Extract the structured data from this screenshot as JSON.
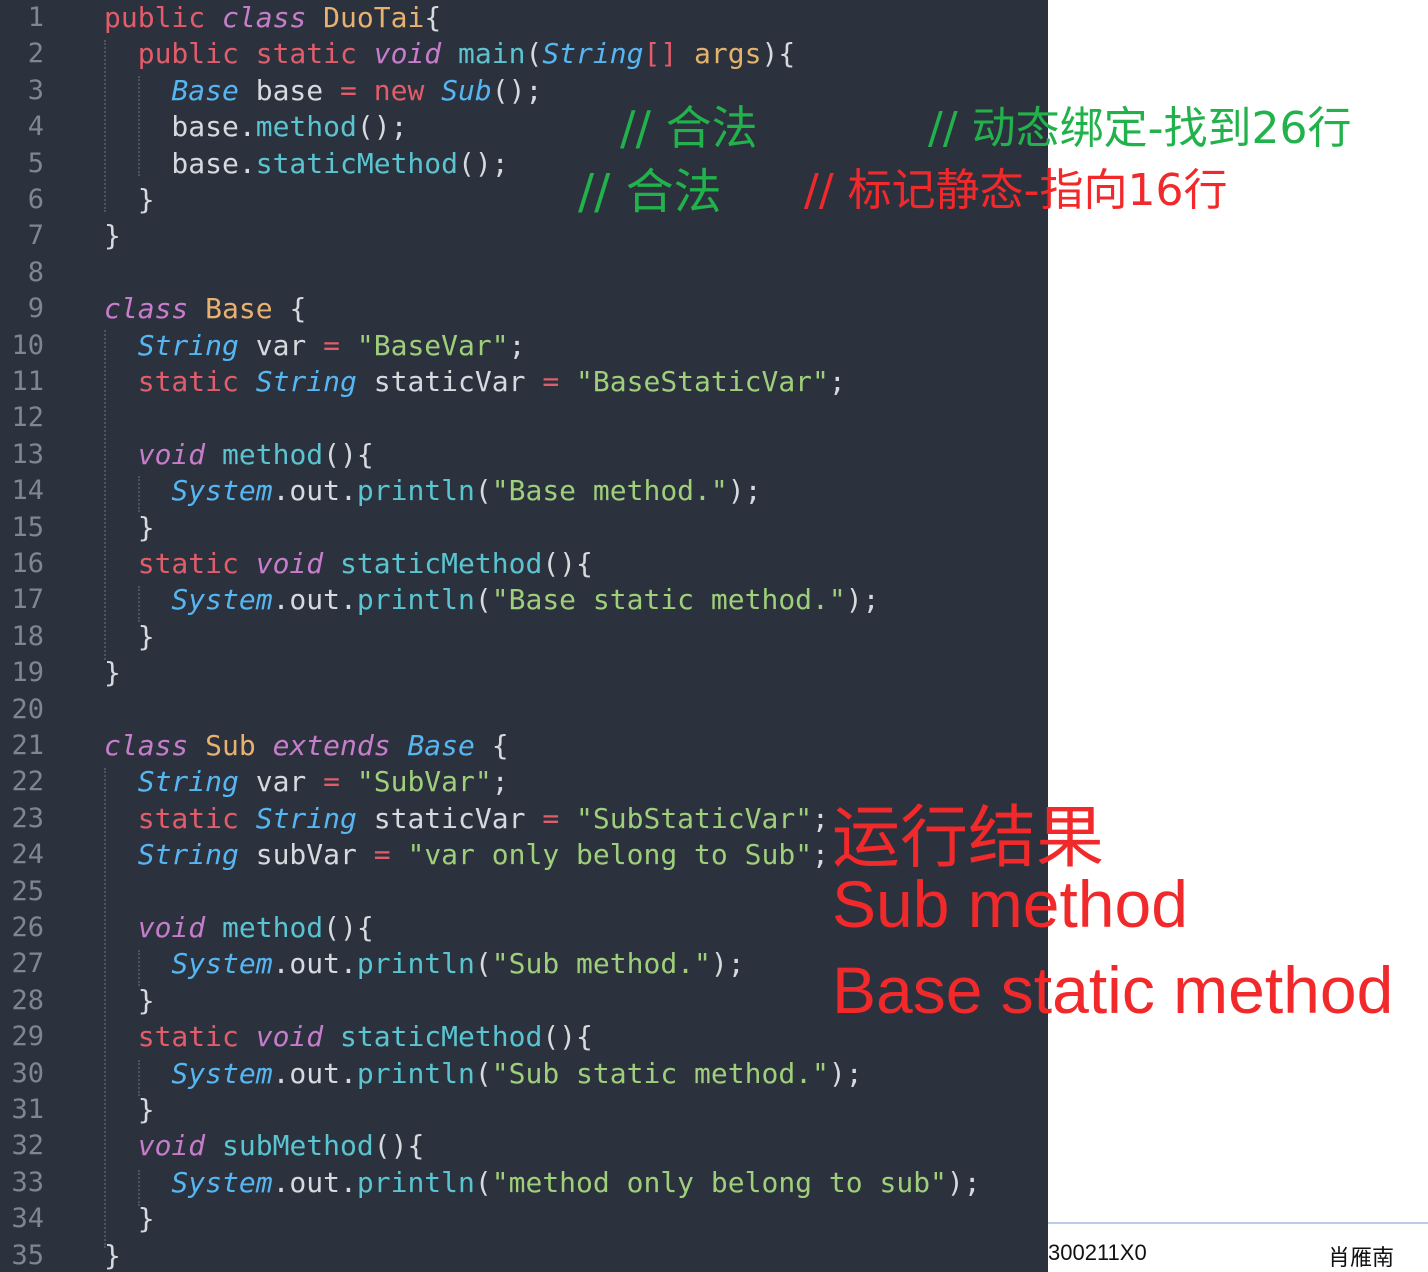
{
  "editor": {
    "line_numbers": [
      "1",
      "2",
      "3",
      "4",
      "5",
      "6",
      "7",
      "8",
      "9",
      "10",
      "11",
      "12",
      "13",
      "14",
      "15",
      "16",
      "17",
      "18",
      "19",
      "20",
      "21",
      "22",
      "23",
      "24",
      "25",
      "26",
      "27",
      "28",
      "29",
      "30",
      "31",
      "32",
      "33",
      "34",
      "35"
    ],
    "lines": [
      [
        [
          "k",
          "public "
        ],
        [
          "ki",
          "class "
        ],
        [
          "t",
          "DuoTai"
        ],
        [
          "p",
          "{"
        ]
      ],
      [
        [
          "k",
          "  public static "
        ],
        [
          "ki",
          "void "
        ],
        [
          "f",
          "main"
        ],
        [
          "p",
          "("
        ],
        [
          "ti",
          "String"
        ],
        [
          "k",
          "[] "
        ],
        [
          "arg",
          "args"
        ],
        [
          "p",
          "){"
        ]
      ],
      [
        [
          "ti",
          "    Base "
        ],
        [
          "p",
          "base "
        ],
        [
          "k",
          "= new "
        ],
        [
          "ti",
          "Sub"
        ],
        [
          "p",
          "();"
        ]
      ],
      [
        [
          "p",
          "    base."
        ],
        [
          "f",
          "method"
        ],
        [
          "p",
          "();"
        ]
      ],
      [
        [
          "p",
          "    base."
        ],
        [
          "f",
          "staticMethod"
        ],
        [
          "p",
          "();"
        ]
      ],
      [
        [
          "p",
          "  }"
        ]
      ],
      [
        [
          "p",
          "}"
        ]
      ],
      [],
      [
        [
          "ki",
          "class "
        ],
        [
          "t",
          "Base "
        ],
        [
          "p",
          "{"
        ]
      ],
      [
        [
          "ti",
          "  String "
        ],
        [
          "p",
          "var "
        ],
        [
          "k",
          "= "
        ],
        [
          "q",
          "\""
        ],
        [
          "s",
          "BaseVar"
        ],
        [
          "q",
          "\""
        ],
        [
          "p",
          ";"
        ]
      ],
      [
        [
          "k",
          "  static "
        ],
        [
          "ti",
          "String "
        ],
        [
          "p",
          "staticVar "
        ],
        [
          "k",
          "= "
        ],
        [
          "q",
          "\""
        ],
        [
          "s",
          "BaseStaticVar"
        ],
        [
          "q",
          "\""
        ],
        [
          "p",
          ";"
        ]
      ],
      [],
      [
        [
          "ki",
          "  void "
        ],
        [
          "f",
          "method"
        ],
        [
          "p",
          "(){"
        ]
      ],
      [
        [
          "ti",
          "    System"
        ],
        [
          "p",
          ".out."
        ],
        [
          "f",
          "println"
        ],
        [
          "p",
          "("
        ],
        [
          "q",
          "\""
        ],
        [
          "s",
          "Base method."
        ],
        [
          "q",
          "\""
        ],
        [
          "p",
          ");"
        ]
      ],
      [
        [
          "p",
          "  }"
        ]
      ],
      [
        [
          "k",
          "  static "
        ],
        [
          "ki",
          "void "
        ],
        [
          "f",
          "staticMethod"
        ],
        [
          "p",
          "(){"
        ]
      ],
      [
        [
          "ti",
          "    System"
        ],
        [
          "p",
          ".out."
        ],
        [
          "f",
          "println"
        ],
        [
          "p",
          "("
        ],
        [
          "q",
          "\""
        ],
        [
          "s",
          "Base static method."
        ],
        [
          "q",
          "\""
        ],
        [
          "p",
          ");"
        ]
      ],
      [
        [
          "p",
          "  }"
        ]
      ],
      [
        [
          "p",
          "}"
        ]
      ],
      [],
      [
        [
          "ki",
          "class "
        ],
        [
          "t",
          "Sub "
        ],
        [
          "ki",
          "extends "
        ],
        [
          "ti",
          "Base "
        ],
        [
          "p",
          "{"
        ]
      ],
      [
        [
          "ti",
          "  String "
        ],
        [
          "p",
          "var "
        ],
        [
          "k",
          "= "
        ],
        [
          "q",
          "\""
        ],
        [
          "s",
          "SubVar"
        ],
        [
          "q",
          "\""
        ],
        [
          "p",
          ";"
        ]
      ],
      [
        [
          "k",
          "  static "
        ],
        [
          "ti",
          "String "
        ],
        [
          "p",
          "staticVar "
        ],
        [
          "k",
          "= "
        ],
        [
          "q",
          "\""
        ],
        [
          "s",
          "SubStaticVar"
        ],
        [
          "q",
          "\""
        ],
        [
          "p",
          ";"
        ]
      ],
      [
        [
          "ti",
          "  String "
        ],
        [
          "p",
          "subVar "
        ],
        [
          "k",
          "= "
        ],
        [
          "q",
          "\""
        ],
        [
          "s",
          "var only belong to Sub"
        ],
        [
          "q",
          "\""
        ],
        [
          "p",
          ";"
        ]
      ],
      [],
      [
        [
          "ki",
          "  void "
        ],
        [
          "f",
          "method"
        ],
        [
          "p",
          "(){"
        ]
      ],
      [
        [
          "ti",
          "    System"
        ],
        [
          "p",
          ".out."
        ],
        [
          "f",
          "println"
        ],
        [
          "p",
          "("
        ],
        [
          "q",
          "\""
        ],
        [
          "s",
          "Sub method."
        ],
        [
          "q",
          "\""
        ],
        [
          "p",
          ");"
        ]
      ],
      [
        [
          "p",
          "  }"
        ]
      ],
      [
        [
          "k",
          "  static "
        ],
        [
          "ki",
          "void "
        ],
        [
          "f",
          "staticMethod"
        ],
        [
          "p",
          "(){"
        ]
      ],
      [
        [
          "ti",
          "    System"
        ],
        [
          "p",
          ".out."
        ],
        [
          "f",
          "println"
        ],
        [
          "p",
          "("
        ],
        [
          "q",
          "\""
        ],
        [
          "s",
          "Sub static method."
        ],
        [
          "q",
          "\""
        ],
        [
          "p",
          ");"
        ]
      ],
      [
        [
          "p",
          "  }"
        ]
      ],
      [
        [
          "ki",
          "  void "
        ],
        [
          "f",
          "subMethod"
        ],
        [
          "p",
          "(){"
        ]
      ],
      [
        [
          "ti",
          "    System"
        ],
        [
          "p",
          ".out."
        ],
        [
          "f",
          "println"
        ],
        [
          "p",
          "("
        ],
        [
          "q",
          "\""
        ],
        [
          "s",
          "method only belong to sub"
        ],
        [
          "q",
          "\""
        ],
        [
          "p",
          ");"
        ]
      ],
      [
        [
          "p",
          "  }"
        ]
      ],
      [
        [
          "p",
          "}"
        ]
      ]
    ]
  },
  "annotations": {
    "line4_legal": "// 合法",
    "line4_dynamic": "// 动态绑定-找到26行",
    "line5_legal": "// 合法",
    "line5_static": "// 标记静态-指向16行",
    "result_title": "运行结果",
    "result_line1": "Sub method",
    "result_line2": "Base static method"
  },
  "document": {
    "id_fragment": "300211X0",
    "name": "肖雁南"
  },
  "colors": {
    "editor_bg": "#2b323d",
    "annotation_green": "#22b24c",
    "annotation_red": "#f2292a"
  }
}
